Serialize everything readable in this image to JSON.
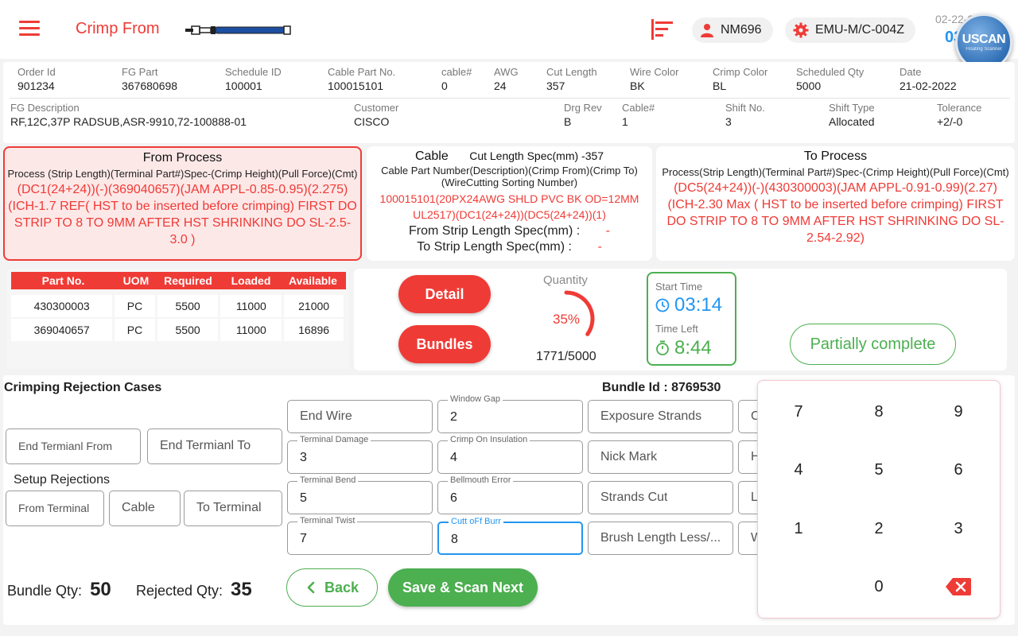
{
  "header": {
    "title": "Crimp From",
    "user_chip": "NM696",
    "machine_chip": "EMU-M/C-004Z",
    "date": "02-22-2022",
    "time": "03:14",
    "scanner_brand": "USCAN",
    "scanner_sub": "Floating Scanner"
  },
  "info": {
    "row1": [
      {
        "label": "Order Id",
        "value": "901234"
      },
      {
        "label": "FG Part",
        "value": "367680698"
      },
      {
        "label": "Schedule ID",
        "value": "100001"
      },
      {
        "label": "Cable Part No.",
        "value": "100015101"
      },
      {
        "label": "cable#",
        "value": "0"
      },
      {
        "label": "AWG",
        "value": "24"
      },
      {
        "label": "Cut Length",
        "value": "357"
      },
      {
        "label": "Wire Color",
        "value": "BK"
      },
      {
        "label": "Crimp Color",
        "value": "BL"
      },
      {
        "label": "Scheduled Qty",
        "value": "5000"
      },
      {
        "label": "Date",
        "value": "21-02-2022"
      }
    ],
    "row2": [
      {
        "label": "FG Description",
        "value": "RF,12C,37P RADSUB,ASR-9910,72-100888-01"
      },
      {
        "label": "Customer",
        "value": "CISCO"
      },
      {
        "label": "Drg Rev",
        "value": "B"
      },
      {
        "label": "Cable#",
        "value": "1"
      },
      {
        "label": "Shift No.",
        "value": "3"
      },
      {
        "label": "Shift Type",
        "value": "Allocated"
      },
      {
        "label": "Tolerance",
        "value": "+2/-0"
      }
    ]
  },
  "from_process": {
    "title": "From Process",
    "subtitle": "Process (Strip Length)(Terminal Part#)Spec-(Crimp Height)(Pull Force)(Cmt)",
    "detail": "(DC1(24+24))(-)(369040657)(JAM APPL-0.85-0.95)(2.275)(ICH-1.7 REF( HST to be inserted before crimping) FIRST DO STRIP TO 8 TO 9MM AFTER HST SHRINKING DO SL-2.5-3.0 )"
  },
  "cable": {
    "title": "Cable",
    "cut_length_spec": "Cut Length Spec(mm) -357",
    "subtitle": "Cable Part Number(Description)(Crimp From)(Crimp To)(WireCutting Sorting Number)",
    "detail": "100015101(20PX24AWG SHLD PVC BK OD=12MM UL2517)(DC1(24+24))(DC5(24+24))(1)",
    "from_strip_label": "From Strip Length Spec(mm) :",
    "from_strip_value": "-",
    "to_strip_label": "To Strip Length Spec(mm) :",
    "to_strip_value": "-"
  },
  "to_process": {
    "title": "To Process",
    "subtitle": "Process(Strip Length)(Terminal Part#)Spec-(Crimp Height)(Pull Force)(Cmt)",
    "detail": "(DC5(24+24))(-)(430300003)(JAM APPL-0.91-0.99)(2.27)(ICH-2.30 Max ( HST to be inserted before crimping) FIRST DO STRIP TO 8 TO 9MM AFTER HST SHRINKING DO SL-2.54-2.92)"
  },
  "parts": {
    "headers": [
      "Part No.",
      "UOM",
      "Required",
      "Loaded",
      "Available"
    ],
    "rows": [
      [
        "430300003",
        "PC",
        "5500",
        "11000",
        "21000"
      ],
      [
        "369040657",
        "PC",
        "5500",
        "11000",
        "16896"
      ]
    ]
  },
  "status": {
    "detail_label": "Detail",
    "bundles_label": "Bundles",
    "quantity_label": "Quantity",
    "quantity_percent": "35%",
    "quantity_fraction": 0.35,
    "quantity_count": "1771/5000",
    "start_time_label": "Start Time",
    "start_time": "03:14",
    "time_left_label": "Time Left",
    "time_left": "8:44",
    "partial_label": "Partially  complete"
  },
  "rejection": {
    "title": "Crimping Rejection Cases",
    "bundle_id": "Bundle Id : 8769530",
    "end_terminal_from": "End Termianl  From",
    "end_terminal_to": "End Termianl  To",
    "setup_title": "Setup Rejections",
    "from_terminal": "From Terminal",
    "cable": "Cable",
    "to_terminal": "To Terminal",
    "col1": [
      {
        "label": "",
        "value": "",
        "placeholder": "End Wire"
      },
      {
        "label": "Terminal Damage",
        "value": "3"
      },
      {
        "label": "Terminal Bend",
        "value": "5"
      },
      {
        "label": "Terminal Twist",
        "value": "7"
      }
    ],
    "col2": [
      {
        "label": "Window Gap",
        "value": "2"
      },
      {
        "label": "Crimp On Insulation",
        "value": "4"
      },
      {
        "label": "Bellmouth Error",
        "value": "6"
      },
      {
        "label": "Cutt oFf Burr",
        "value": "8"
      }
    ],
    "col3": [
      "Exposure Strands",
      "Nick Mark",
      "Strands Cut",
      "Brush Length Less/..."
    ],
    "col4": [
      "C",
      "H",
      "L",
      "W"
    ]
  },
  "footer": {
    "bundle_qty_label": "Bundle Qty:",
    "bundle_qty": "50",
    "rejected_qty_label": "Rejected Qty:",
    "rejected_qty": "35",
    "back_label": "Back",
    "save_label": "Save & Scan Next"
  },
  "keypad": {
    "keys": [
      "7",
      "8",
      "9",
      "4",
      "5",
      "6",
      "1",
      "2",
      "3",
      "0"
    ]
  },
  "colors": {
    "accent_red": "#ef3b36",
    "accent_green": "#4caf50",
    "accent_blue": "#2196f3"
  }
}
